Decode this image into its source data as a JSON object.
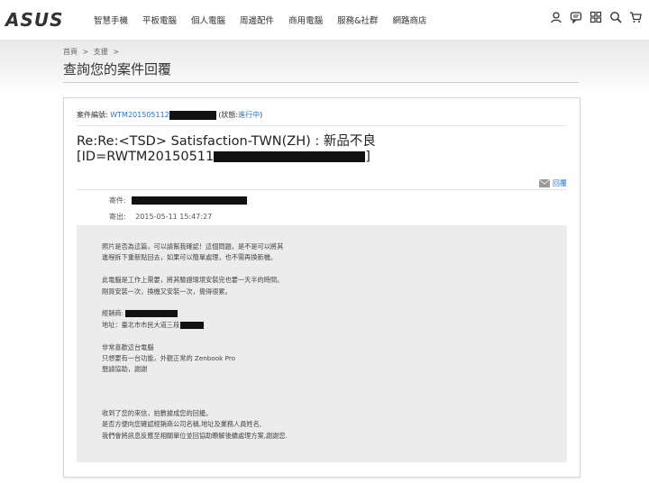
{
  "brand": {
    "logo": "ASUS"
  },
  "nav": [
    "智慧手機",
    "平板電腦",
    "個人電腦",
    "周邊配件",
    "商用電腦",
    "服務&社群",
    "網路商店"
  ],
  "utils": [
    "user-icon",
    "chat-icon",
    "compare-icon",
    "search-icon",
    "cart-icon"
  ],
  "breadcrumb": {
    "home": "首頁",
    "support": "支援",
    "sep": ">"
  },
  "page_title": "查詢您的案件回覆",
  "case": {
    "label": "案件編號:",
    "number_visible": "WTM201505112",
    "status_prefix": "(狀態:",
    "status": "進行中",
    "status_suffix": ")"
  },
  "subject": {
    "line1": "Re:Re:<TSD> Satisfaction-TWN(ZH) : 新品不良",
    "line2_visible": "[ID=RWTM20150511",
    "line2_end": "]"
  },
  "reply": {
    "label": "回覆"
  },
  "meta": {
    "from_label": "寄件:",
    "sent_label": "寄出:",
    "sent_value": "2015-05-11 15:47:27"
  },
  "message": {
    "p1": [
      "照片是否為這篇，可以請幫我確認！這個問題，是不是可以將其",
      "進程拆下重新點回去，如果可以簡單處理，也不需再換新機。"
    ],
    "p2": [
      "此電腦是工作上需要，將其驗證環境安裝完也要一天半的時間。",
      "剛買安裝一次，換機又安裝一次，覺得很累。"
    ],
    "p3_label1": "經銷商:",
    "p3_label2": "地址：臺北市市民大道三段",
    "p4": [
      "非常喜歡這台電腦",
      "只想要有一台功能，外觀正常的 Zenbook Pro",
      "懇請協助，謝謝"
    ],
    "p5": [
      "收到了您的來信，拍數據成您的回擾。",
      "是否方便向您確認經銷商公司名稱,地址及業務人員姓名,",
      "我們會將訊息反應至相關單位並回協助瞭解後續處理方案,謝謝您."
    ]
  }
}
